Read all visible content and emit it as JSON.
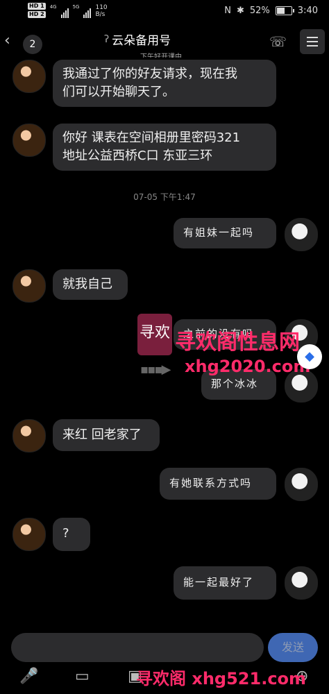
{
  "status_bar": {
    "hd1": "HD 1",
    "hd2": "HD 2",
    "net_4g": "4G",
    "net_5g": "5G",
    "speed_value": "110",
    "speed_unit": "B/s",
    "battery": "52%",
    "time": "3:40",
    "nfc": "N",
    "bt": "✱"
  },
  "header": {
    "back": "‹",
    "unread_count": "2",
    "title": "云朵备用号",
    "subtitle": "下午好开课中",
    "ear_icon": "ʔ",
    "phone_icon": "☏"
  },
  "messages": [
    {
      "from": "other",
      "text_line1": "我通过了你的好友请求，现在我",
      "text_line2": "们可以开始聊天了。"
    },
    {
      "from": "other",
      "text_line1": "你好  课表在空间相册里密码321",
      "text_line2": "地址公益西桥C口 东亚三环"
    },
    {
      "timestamp": "07-05 下午1:47"
    },
    {
      "from": "self",
      "text": "有姐妹一起吗"
    },
    {
      "from": "other",
      "text": "就我自己"
    },
    {
      "from": "self",
      "text": "之前的没有吗"
    },
    {
      "from": "self",
      "text": "那个冰冰"
    },
    {
      "from": "other",
      "text": "来红 回老家了"
    },
    {
      "from": "self",
      "text": "有她联系方式吗"
    },
    {
      "from": "other",
      "text": "?"
    },
    {
      "from": "self",
      "text": "能一起最好了"
    }
  ],
  "watermark": {
    "logo": "寻欢",
    "brand": "寻欢阁性息网",
    "url": "xhg2020.com",
    "footer": "寻欢阁 xhg521.com",
    "arrow": "▪▪▪▶",
    "badge": "◆"
  },
  "input": {
    "send_label": "发送"
  },
  "toolbar": {
    "mic": "🎤",
    "cast": "▭",
    "image": "▣",
    "plus": "⊕"
  }
}
